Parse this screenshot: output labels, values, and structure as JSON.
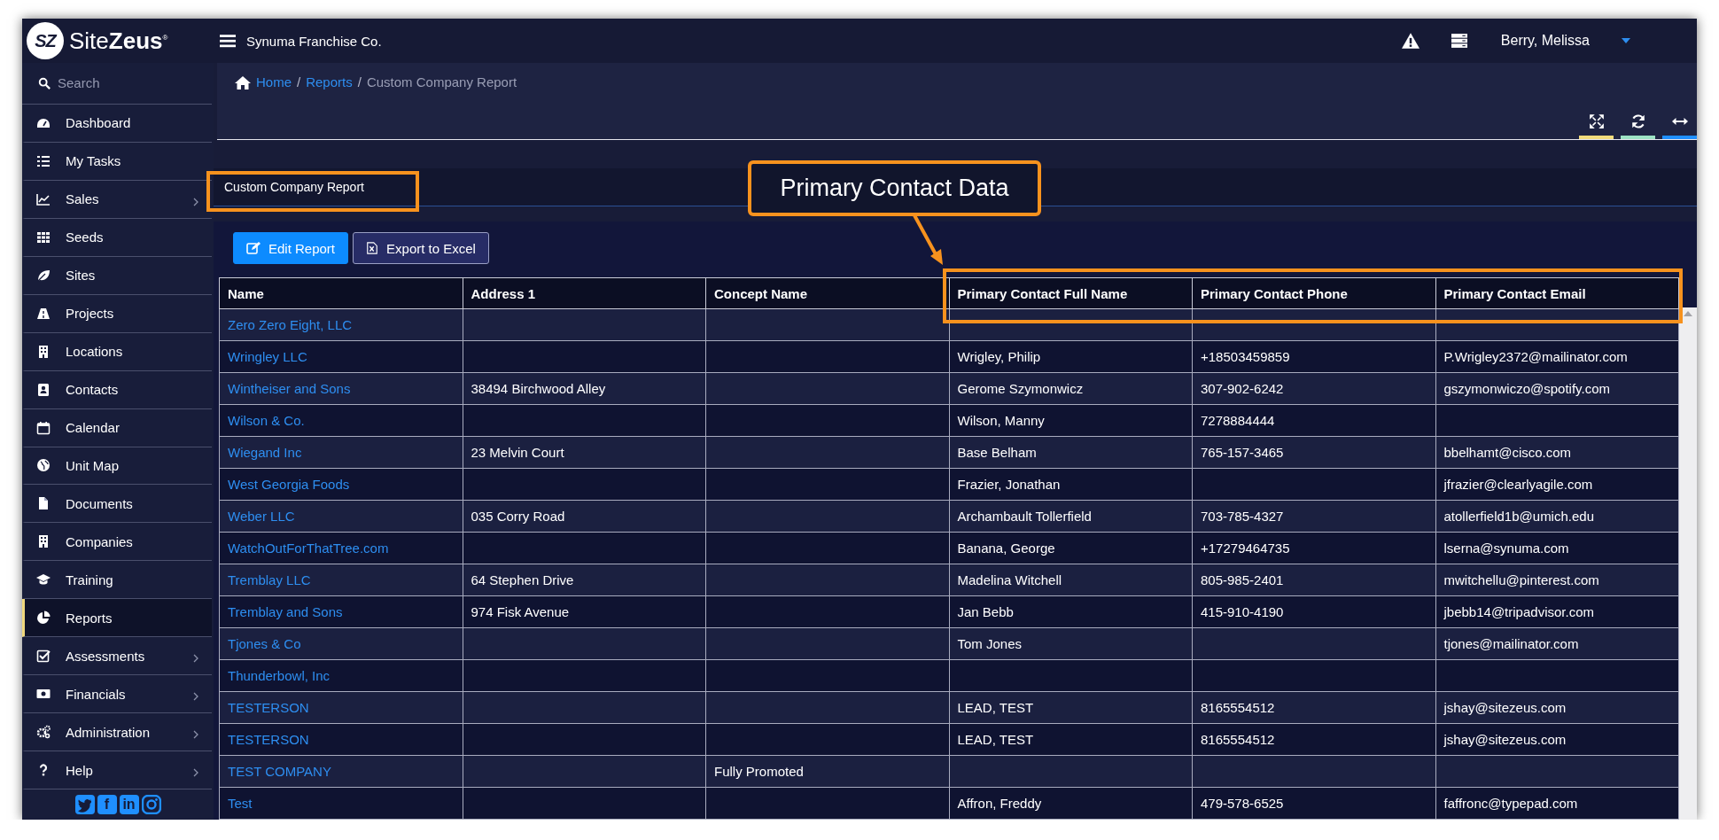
{
  "topbar": {
    "logo_mark": "SZ",
    "logo_text": "Site**Zeus**$^{®}$",
    "company": "Synuma Franchise Co.",
    "user": "Berry, Melissa"
  },
  "sidebar": {
    "search": {
      "placeholder": "Search"
    },
    "items": [
      {
        "label": "Dashboard",
        "selected": false,
        "has_submenu": false
      },
      {
        "label": "My Tasks",
        "selected": false,
        "has_submenu": false
      },
      {
        "label": "Sales",
        "selected": false,
        "has_submenu": true
      },
      {
        "label": "Seeds",
        "selected": false,
        "has_submenu": false
      },
      {
        "label": "Sites",
        "selected": false,
        "has_submenu": false
      },
      {
        "label": "Projects",
        "selected": false,
        "has_submenu": false
      },
      {
        "label": "Locations",
        "selected": false,
        "has_submenu": false
      },
      {
        "label": "Contacts",
        "selected": false,
        "has_submenu": false
      },
      {
        "label": "Calendar",
        "selected": false,
        "has_submenu": false
      },
      {
        "label": "Unit Map",
        "selected": false,
        "has_submenu": false
      },
      {
        "label": "Documents",
        "selected": false,
        "has_submenu": false
      },
      {
        "label": "Companies",
        "selected": false,
        "has_submenu": false
      },
      {
        "label": "Training",
        "selected": false,
        "has_submenu": false
      },
      {
        "label": "Reports",
        "selected": true,
        "has_submenu": false
      },
      {
        "label": "Assessments",
        "selected": false,
        "has_submenu": true
      },
      {
        "label": "Financials",
        "selected": false,
        "has_submenu": true
      },
      {
        "label": "Administration",
        "selected": false,
        "has_submenu": true
      },
      {
        "label": "Help",
        "selected": false,
        "has_submenu": true
      }
    ],
    "social": [
      {
        "kind": "bird"
      },
      {
        "kind": "letter",
        "glyph": "f"
      },
      {
        "kind": "letter",
        "glyph": "in"
      },
      {
        "kind": "camera"
      }
    ]
  },
  "breadcrumb": [
    {
      "label": "Home",
      "link": true,
      "separator": "/"
    },
    {
      "label": "Reports",
      "link": true,
      "separator": "/"
    },
    {
      "label": "Custom Company Report",
      "link": false
    }
  ],
  "toolbar": [
    {
      "color": "#f2dc7c"
    },
    {
      "color": "#9de3c4"
    },
    {
      "color": "#1f8fff"
    }
  ],
  "panel": {
    "title": "Custom Company Report",
    "buttons": [
      {
        "label": "Edit Report",
        "kind": "primary"
      },
      {
        "label": "Export to Excel",
        "kind": "secondary"
      }
    ],
    "table": {
      "columns": [
        "Name",
        "Address 1",
        "Concept Name",
        "Primary Contact Full Name",
        "Primary Contact Phone",
        "Primary Contact Email"
      ],
      "rows": [
        [
          "Zero Zero Eight, LLC",
          null,
          null,
          null,
          null,
          null
        ],
        [
          "Wringley LLC",
          null,
          null,
          "Wrigley, Philip",
          "+18503459859",
          "P.Wrigley2372@mailinator.com"
        ],
        [
          "Wintheiser and Sons",
          "38494 Birchwood Alley",
          null,
          "Gerome Szymonwicz",
          "307-902-6242",
          "gszymonwiczo@spotify.com"
        ],
        [
          "Wilson & Co.",
          null,
          null,
          "Wilson, Manny",
          "7278884444",
          null
        ],
        [
          "Wiegand Inc",
          "23 Melvin Court",
          null,
          "Base Belham",
          "765-157-3465",
          "bbelhamt@cisco.com"
        ],
        [
          "West Georgia Foods",
          null,
          null,
          "Frazier, Jonathan",
          null,
          "jfrazier@clearlyagile.com"
        ],
        [
          "Weber LLC",
          "035 Corry Road",
          null,
          "Archambault Tollerfield",
          "703-785-4327",
          "atollerfield1b@umich.edu"
        ],
        [
          "WatchOutForThatTree.com",
          null,
          null,
          "Banana, George",
          "+17279464735",
          "lserna@synuma.com"
        ],
        [
          "Tremblay LLC",
          "64 Stephen Drive",
          null,
          "Madelina Witchell",
          "805-985-2401",
          "mwitchellu@pinterest.com"
        ],
        [
          "Tremblay and Sons",
          "974 Fisk Avenue",
          null,
          "Jan Bebb",
          "415-910-4190",
          "jbebb14@tripadvisor.com"
        ],
        [
          "Tjones & Co",
          null,
          null,
          "Tom Jones",
          null,
          "tjones@mailinator.com"
        ],
        [
          "Thunderbowl, Inc",
          null,
          null,
          null,
          null,
          null
        ],
        [
          "TESTERSON",
          null,
          null,
          "LEAD, TEST",
          "8165554512",
          "jshay@sitezeus.com"
        ],
        [
          "TESTERSON",
          null,
          null,
          "LEAD, TEST",
          "8165554512",
          "jshay@sitezeus.com"
        ],
        [
          "TEST COMPANY",
          null,
          "Fully Promoted",
          null,
          null,
          null
        ],
        [
          "Test",
          null,
          null,
          "Affron, Freddy",
          "479-578-6525",
          "faffronc@typepad.com"
        ]
      ]
    }
  },
  "annotations": {
    "callout": "Primary Contact Data"
  }
}
